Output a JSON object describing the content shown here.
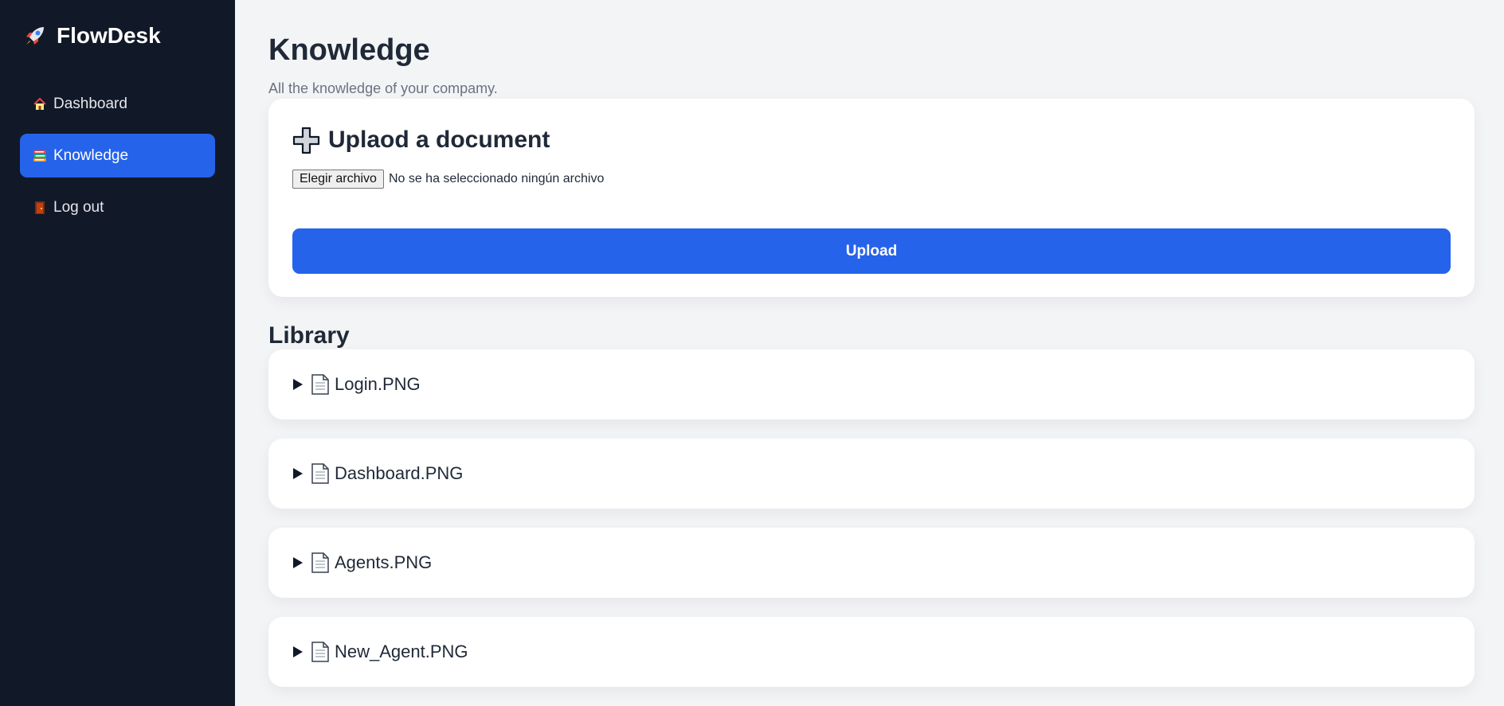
{
  "app": {
    "name": "FlowDesk"
  },
  "sidebar": {
    "items": [
      {
        "label": "Dashboard",
        "icon": "house-icon",
        "active": false
      },
      {
        "label": "Knowledge",
        "icon": "books-icon",
        "active": true
      },
      {
        "label": "Log out",
        "icon": "door-icon",
        "active": false
      }
    ]
  },
  "header": {
    "title": "Knowledge",
    "subtitle": "All the knowledge of your compamy."
  },
  "upload": {
    "heading": "Uplaod a document",
    "choose_file_label": "Elegir archivo",
    "no_file_text": "No se ha seleccionado ningún archivo",
    "button_label": "Upload"
  },
  "library": {
    "title": "Library",
    "documents": [
      {
        "name": "Login.PNG"
      },
      {
        "name": "Dashboard.PNG"
      },
      {
        "name": "Agents.PNG"
      },
      {
        "name": "New_Agent.PNG"
      }
    ]
  },
  "colors": {
    "sidebar_bg": "#111827",
    "accent": "#2563eb",
    "page_bg": "#f3f4f6",
    "card_bg": "#ffffff"
  }
}
